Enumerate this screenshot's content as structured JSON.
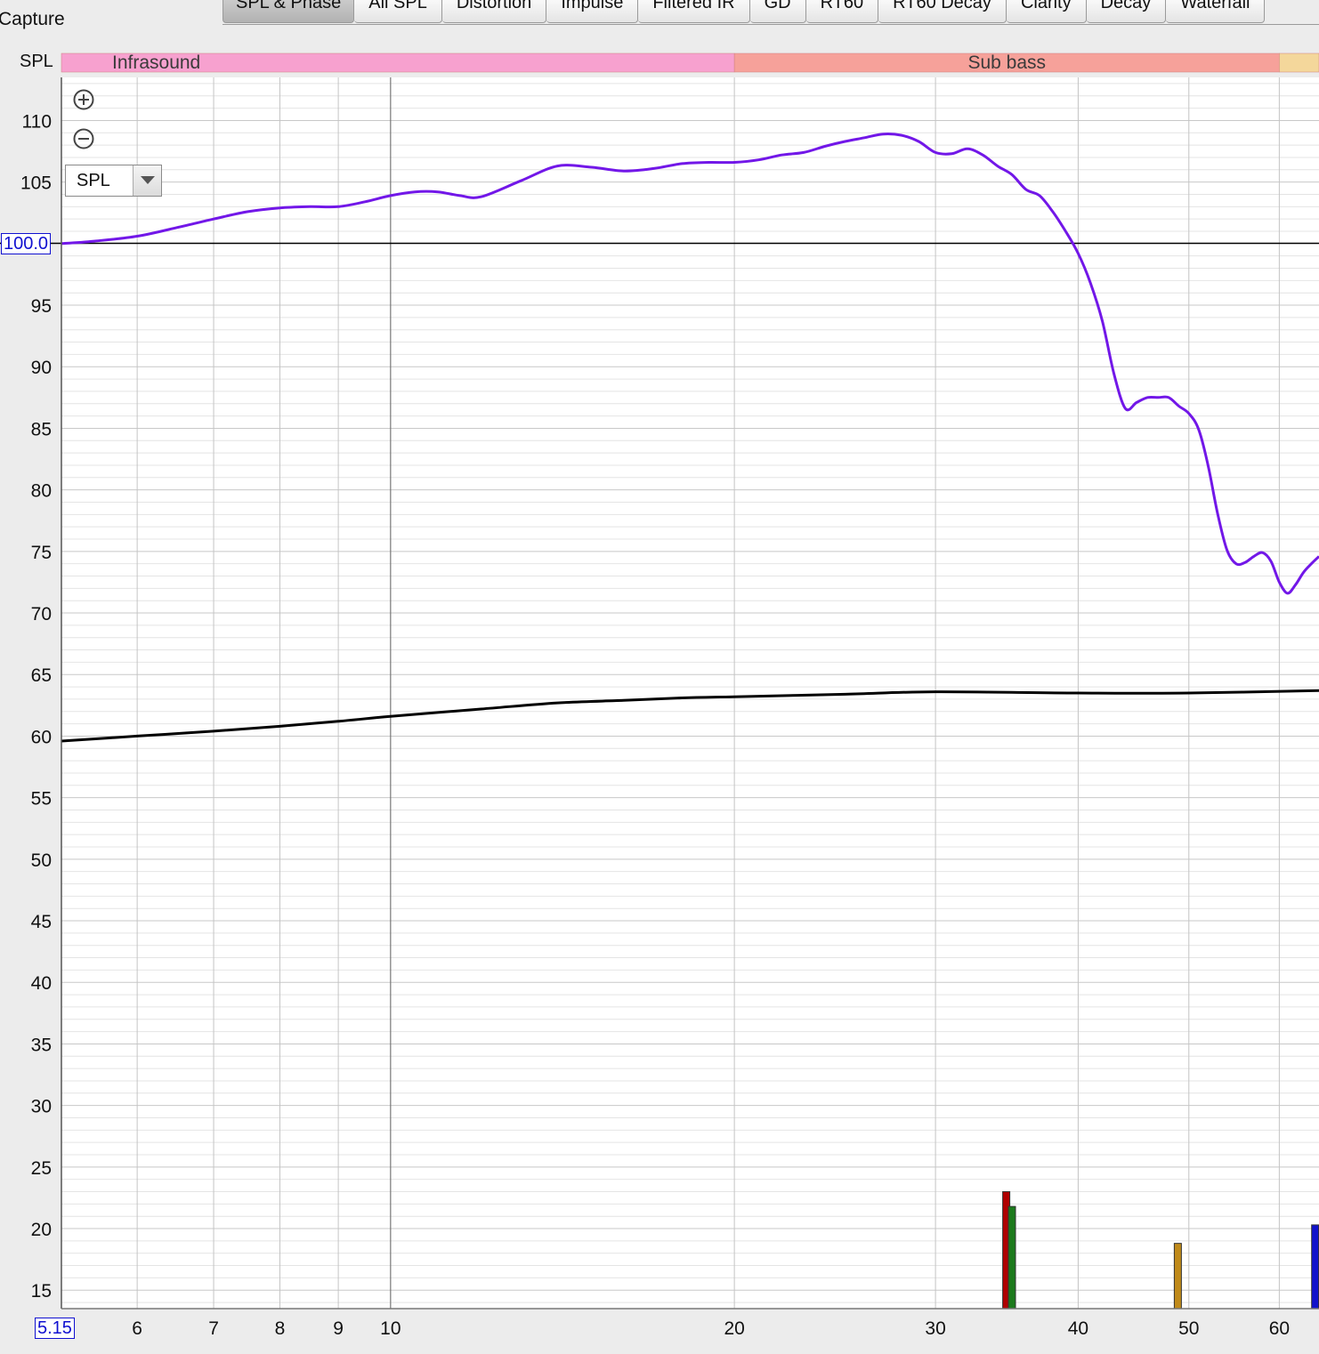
{
  "app": {
    "capture_label": "Capture"
  },
  "tabs": [
    {
      "label": "SPL & Phase",
      "active": true
    },
    {
      "label": "All SPL"
    },
    {
      "label": "Distortion"
    },
    {
      "label": "Impulse"
    },
    {
      "label": "Filtered IR"
    },
    {
      "label": "GD"
    },
    {
      "label": "RT60"
    },
    {
      "label": "RT60 Decay"
    },
    {
      "label": "Clarity"
    },
    {
      "label": "Decay"
    },
    {
      "label": "Waterfall"
    }
  ],
  "plot": {
    "y_axis_label": "SPL",
    "dropdown_value": "SPL",
    "reference_level_label": "100.0",
    "x_start_label": "5.15",
    "zoom_in_icon": "zoom-in-icon",
    "zoom_out_icon": "zoom-out-icon",
    "dropdown_icon": "chevron-down-icon"
  },
  "chart_data": {
    "type": "line",
    "x_scale": "log",
    "xlim": [
      5.15,
      65
    ],
    "ylim": [
      13.5,
      113.5
    ],
    "reference_line": 100.0,
    "grid": true,
    "x_ticks": [
      6,
      7,
      8,
      9,
      10,
      20,
      30,
      40,
      50,
      60
    ],
    "y_ticks": [
      15,
      20,
      25,
      30,
      35,
      40,
      45,
      50,
      55,
      60,
      65,
      70,
      75,
      80,
      85,
      90,
      95,
      110,
      105
    ],
    "bands": [
      {
        "label": "Infrasound",
        "from": 5.15,
        "to": 20,
        "color": "#f7a1cf"
      },
      {
        "label": "Sub bass",
        "from": 20,
        "to": 60,
        "color": "#f6a19a"
      },
      {
        "label": "",
        "from": 60,
        "to": 65,
        "color": "#f4d79b"
      }
    ],
    "series": [
      {
        "color": "#7217e8",
        "x": [
          5.15,
          5.5,
          6,
          6.5,
          7,
          7.5,
          8,
          8.5,
          9,
          9.5,
          10,
          10.5,
          11,
          11.5,
          12,
          13,
          14,
          15,
          16,
          17,
          18,
          19,
          20,
          21,
          22,
          23,
          24,
          25,
          26,
          27,
          28,
          29,
          30,
          31,
          32,
          33,
          34,
          35,
          36,
          37,
          38,
          39,
          40,
          41,
          42,
          43,
          44,
          45,
          46,
          47,
          48,
          49,
          50,
          51,
          52,
          53,
          54,
          55,
          56,
          57,
          58,
          59,
          60,
          61,
          62,
          63,
          64,
          65
        ],
        "y": [
          100.0,
          100.2,
          100.6,
          101.3,
          102.0,
          102.6,
          102.9,
          103.0,
          103.0,
          103.4,
          103.9,
          104.2,
          104.2,
          103.9,
          103.8,
          105.1,
          106.3,
          106.2,
          105.9,
          106.1,
          106.5,
          106.6,
          106.6,
          106.8,
          107.2,
          107.4,
          107.9,
          108.3,
          108.6,
          108.9,
          108.8,
          108.3,
          107.4,
          107.3,
          107.7,
          107.2,
          106.3,
          105.6,
          104.4,
          103.9,
          102.6,
          101.0,
          99.2,
          96.8,
          93.7,
          89.4,
          86.6,
          87.1,
          87.5,
          87.5,
          87.5,
          86.8,
          86.2,
          84.9,
          81.9,
          78.0,
          75.1,
          74.0,
          74.1,
          74.6,
          74.9,
          74.2,
          72.5,
          71.6,
          72.3,
          73.3,
          74.0,
          74.6
        ]
      },
      {
        "color": "#000000",
        "x": [
          5.15,
          6,
          7,
          8,
          9,
          10,
          12,
          14,
          16,
          18,
          20,
          25,
          30,
          40,
          50,
          65
        ],
        "y": [
          59.6,
          60.0,
          60.4,
          60.8,
          61.2,
          61.6,
          62.2,
          62.7,
          62.9,
          63.1,
          63.2,
          63.4,
          63.6,
          63.5,
          63.5,
          63.7
        ]
      }
    ],
    "markers": [
      {
        "x": 34.6,
        "value": 23.0,
        "color": "#b00000"
      },
      {
        "x": 35.0,
        "value": 21.8,
        "color": "#1c7a1c"
      },
      {
        "x": 48.9,
        "value": 18.8,
        "color": "#c08a1a"
      },
      {
        "x": 64.5,
        "value": 20.3,
        "color": "#1212cc"
      }
    ]
  }
}
